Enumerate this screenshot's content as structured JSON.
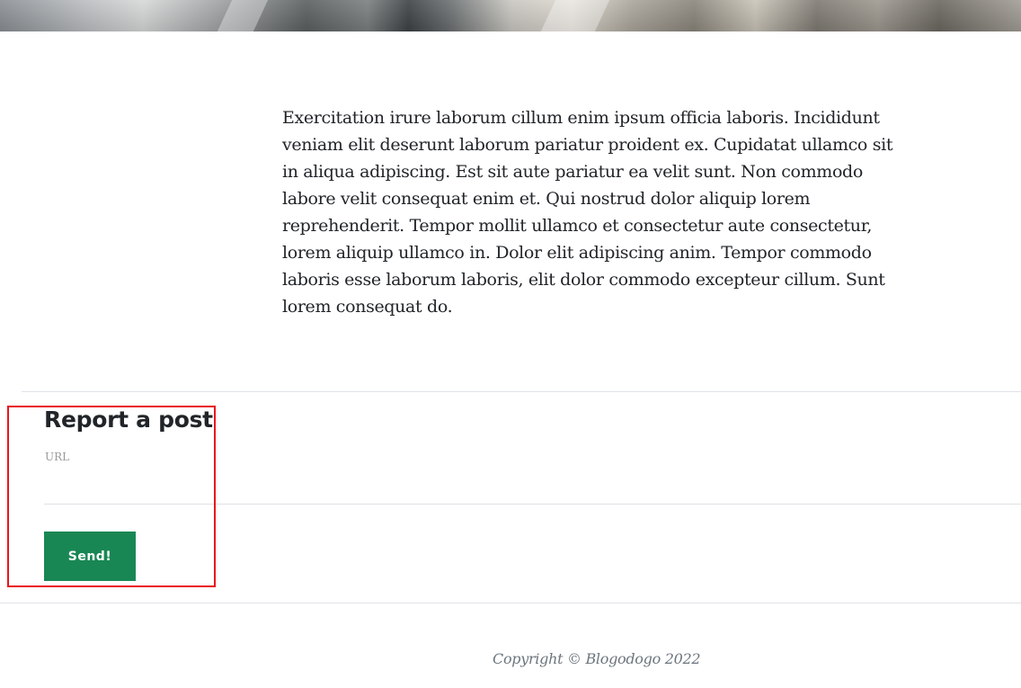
{
  "article": {
    "body": "Exercitation irure laborum cillum enim ipsum officia laboris. Incididunt veniam elit deserunt laborum pariatur proident ex. Cupidatat ullamco sit in aliqua adipiscing. Est sit aute pariatur ea velit sunt. Non commodo labore velit consequat enim et. Qui nostrud dolor aliquip lorem reprehenderit. Tempor mollit ullamco et consectetur aute consectetur, lorem aliquip ullamco in. Dolor elit adipiscing anim. Tempor commodo laboris esse laborum laboris, elit dolor commodo excepteur cillum. Sunt lorem consequat do."
  },
  "report_form": {
    "title": "Report a post",
    "url_label": "URL",
    "url_value": "",
    "send_label": "Send!"
  },
  "footer": {
    "copyright": "Copyright © Blogodogo 2022"
  },
  "colors": {
    "button_bg": "#198754",
    "highlight": "#e8141b",
    "text": "#212529",
    "muted": "#6c757d"
  }
}
